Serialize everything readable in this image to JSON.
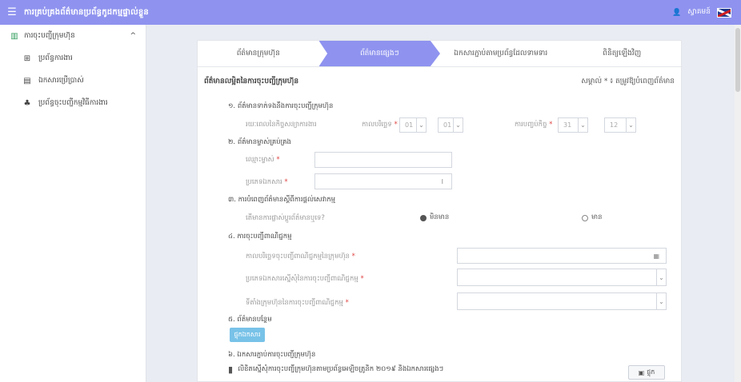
{
  "header": {
    "menu_icon": "hamburger-icon",
    "title": "ការគ្រប់គ្រងព័ត៌មានប្រព័ន្ធកូដកម្មផ្ទាល់ខ្លួន",
    "user_icon": "user-icon",
    "user_name": "ស្វាគមន៍",
    "language_icon": "uk-flag-icon"
  },
  "sidebar": {
    "group": {
      "icon": "building-icon",
      "label": "ការចុះបញ្ជីក្រុមហ៊ុន",
      "chevron": "^"
    },
    "items": [
      {
        "icon": "grid-icon",
        "label": "ប្រព័ន្ធការងារ"
      },
      {
        "icon": "folder-icon",
        "label": "ឯកសារប្រើប្រាស់"
      },
      {
        "icon": "tree-icon",
        "label": "ប្រព័ន្ធចុះបញ្ជីកម្មវិធីការងារ"
      }
    ]
  },
  "steps": [
    {
      "label": "ព័ត៌មានក្រុមហ៊ុន",
      "active": false
    },
    {
      "label": "ព័ត៌មានផ្សេងៗ",
      "active": true
    },
    {
      "label": "ឯកសារភ្ជាប់តាមប្រព័ន្ធដែលទាមទារ",
      "active": false
    },
    {
      "label": "ពិនិត្យឡើងវិញ",
      "active": false
    }
  ],
  "form": {
    "title": "ព័ត៌មានលម្អិតនៃការចុះបញ្ជីក្រុមហ៊ុន",
    "note": "សម្គាល់ * ៖ តម្រូវឱ្យបំពេញព័ត៌មាន",
    "sec1": {
      "title": "១. ព័ត៌មានទាក់ទងនឹងការចុះបញ្ជីក្រុមហ៊ុន",
      "row_label": "រយៈពេលនៃកិច្ចសន្យាការងារ",
      "start_label": "កាលបរិច្ឆេទ",
      "start_val1": "01",
      "start_val2": "01",
      "end_label": "ការបញ្ចប់កិច្ច",
      "end_val1": "31",
      "end_val2": "12"
    },
    "sec2": {
      "title": "២. ព័ត៌មានម្ចាស់គ្រប់គ្រង",
      "label1": "ឈ្មោះម្ចាស់",
      "label2": "ប្រភេទឯកសារ",
      "input2_value": "I"
    },
    "sec3": {
      "title": "៣. ការបំពេញព័ត៌មានស្តីពីការផ្តល់សេវាកម្ម",
      "question": "តើមានការផ្លាស់ប្តូរព័ត៌មានឬទេ?",
      "opt_yes": "មិនមាន",
      "opt_no": "មាន"
    },
    "sec4": {
      "title": "៤. ការចុះបញ្ជីពាណិជ្ជកម្ម",
      "label1": "កាលបរិច្ឆេទចុះបញ្ជីពាណិជ្ជកម្មនៃក្រុមហ៊ុន",
      "label2": "ប្រភេទឯកសារស្នើសុំនៃការចុះបញ្ជីពាណិជ្ជកម្ម",
      "label3": "ទីតាំងក្រុមហ៊ុននៃការចុះបញ្ជីពាណិជ្ជកម្ម",
      "date_icon": "calendar-icon"
    },
    "sec5": {
      "title": "៥. ព័ត៌មានបន្ថែម",
      "button": "ផ្ទុកឯកសារ"
    },
    "sec6": {
      "title": "៦. ឯកសារភ្ជាប់ការចុះបញ្ជីក្រុមហ៊ុន",
      "file_text": "លិខិតស្នើសុំការចុះបញ្ជីក្រុមហ៊ុនតាមប្រព័ន្ធអេឡិចត្រូនិក ២០១៩ និងឯកសារផ្សេងៗ",
      "button": "ផ្ទុក"
    }
  }
}
